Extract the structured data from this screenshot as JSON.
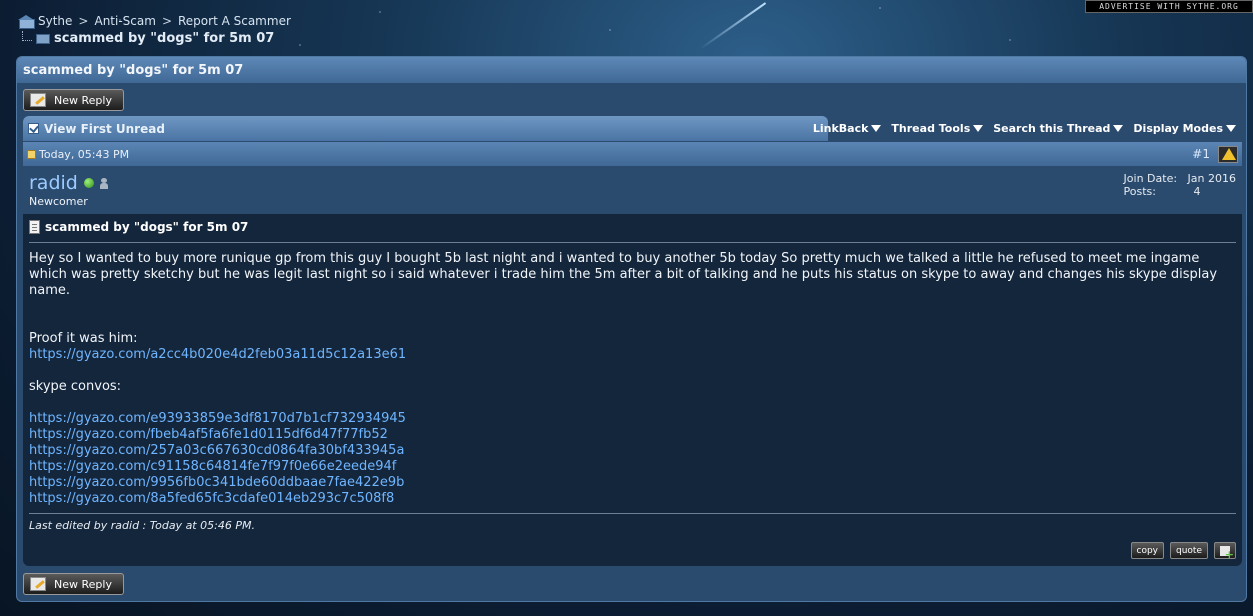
{
  "ad": {
    "text": "ADVERTISE WITH SYTHE.ORG"
  },
  "breadcrumb": {
    "items": [
      "Sythe",
      "Anti-Scam",
      "Report A Scammer"
    ],
    "separator": ">",
    "current": "scammed by \"dogs\" for 5m 07"
  },
  "thread": {
    "title": "scammed by \"dogs\" for 5m 07",
    "new_reply_label": "New Reply",
    "view_first_unread": "View First Unread",
    "menus": [
      "LinkBack",
      "Thread Tools",
      "Search this Thread",
      "Display Modes"
    ]
  },
  "post": {
    "date": "Today, 05:43 PM",
    "number": "#1",
    "username": "radid",
    "user_title": "Newcomer",
    "join_date_label": "Join Date:",
    "join_date": "Jan 2016",
    "posts_label": "Posts:",
    "posts": "4",
    "title": "scammed by \"dogs\" for 5m 07",
    "body_intro": "Hey so I wanted to buy more runique gp from this guy I bought 5b last night and i wanted to buy another 5b today So pretty much we talked a little he refused to meet me ingame which was pretty sketchy but he was legit last night so i said whatever i trade him the 5m after a bit of talking and he puts his status on skype to away and changes his skype display name.",
    "proof_label": "Proof it was him:",
    "proof_link": "https://gyazo.com/a2cc4b020e4d2feb03a11d5c12a13e61",
    "skype_label": "skype convos:",
    "links": [
      "https://gyazo.com/e93933859e3df8170d7b1cf732934945",
      "https://gyazo.com/fbeb4af5fa6fe1d0115df6d47f77fb52",
      "https://gyazo.com/257a03c667630cd0864fa30bf433945a",
      "https://gyazo.com/c91158c64814fe7f97f0e66e2eede94f",
      "https://gyazo.com/9956fb0c341bde60ddbaae7fae422e9b",
      "https://gyazo.com/8a5fed65fc3cdafe014eb293c7c508f8"
    ],
    "edited": "Last edited by radid : Today at 05:46 PM.",
    "copy_label": "copy",
    "quote_label": "quote"
  }
}
